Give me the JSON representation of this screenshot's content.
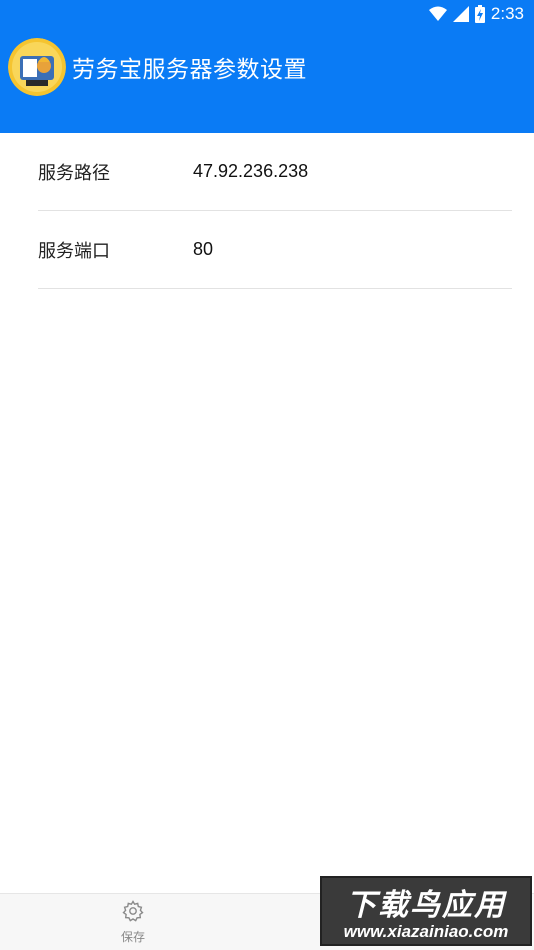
{
  "status_bar": {
    "time": "2:33",
    "icons": [
      "wifi-icon",
      "cell-signal-icon",
      "battery-charging-icon"
    ]
  },
  "app_bar": {
    "title": "劳务宝服务器参数设置",
    "logo_icon": "app-logo-icon"
  },
  "settings": {
    "rows": [
      {
        "label": "服务路径",
        "value": "47.92.236.238"
      },
      {
        "label": "服务端口",
        "value": "80"
      }
    ]
  },
  "bottom_bar": {
    "save_label": "保存",
    "save_icon": "gear-icon"
  },
  "watermark": {
    "title": "下载鸟应用",
    "url": "www.xiazainiao.com"
  },
  "colors": {
    "primary": "#0a7bf5",
    "divider": "#e2e2e2",
    "bottom_bar_bg": "#f7f7f7"
  }
}
